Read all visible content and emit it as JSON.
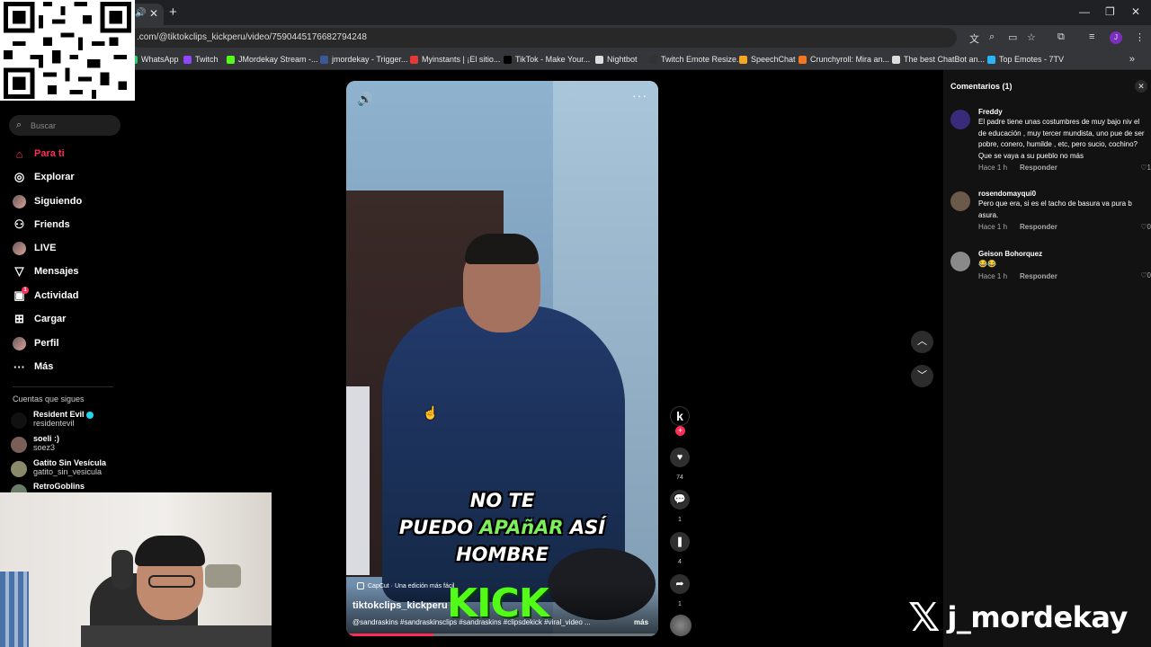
{
  "browser": {
    "url": ".com/@tiktokclips_kickperu/video/7590445176682794248",
    "bookmarks": [
      {
        "label": "WhatsApp",
        "color": "#25d366"
      },
      {
        "label": "Twitch",
        "color": "#9146ff"
      },
      {
        "label": "JMordekay Stream -...",
        "color": "#53fc18"
      },
      {
        "label": "jmordekay - Trigger...",
        "color": "#3b5998"
      },
      {
        "label": "Myinstants | ¡El sitio...",
        "color": "#e53935"
      },
      {
        "label": "TikTok - Make Your...",
        "color": "#000000"
      },
      {
        "label": "Nightbot",
        "color": "#dddddd"
      },
      {
        "label": "Twitch Emote Resize...",
        "color": "#333333"
      },
      {
        "label": "SpeechChat",
        "color": "#f5a623"
      },
      {
        "label": "Crunchyroll: Mira an...",
        "color": "#f47521"
      },
      {
        "label": "The best ChatBot an...",
        "color": "#dddddd"
      },
      {
        "label": "Top Emotes - 7TV",
        "color": "#29b6f6"
      }
    ]
  },
  "sidebar": {
    "search_placeholder": "Buscar",
    "nav": [
      {
        "label": "Para ti",
        "icon": "home-icon",
        "active": true
      },
      {
        "label": "Explorar",
        "icon": "compass-icon"
      },
      {
        "label": "Siguiendo",
        "icon": "following-avatar-icon"
      },
      {
        "label": "Friends",
        "icon": "friends-icon"
      },
      {
        "label": "LIVE",
        "icon": "live-icon"
      },
      {
        "label": "Mensajes",
        "icon": "messages-icon"
      },
      {
        "label": "Actividad",
        "icon": "activity-icon",
        "badge": "1"
      },
      {
        "label": "Cargar",
        "icon": "upload-icon"
      },
      {
        "label": "Perfil",
        "icon": "profile-avatar-icon"
      },
      {
        "label": "Más",
        "icon": "more-icon"
      }
    ],
    "following_title": "Cuentas que sigues",
    "accounts": [
      {
        "name": "Resident Evil",
        "handle": "residentevil",
        "verified": true
      },
      {
        "name": "soeli :)",
        "handle": "soez3"
      },
      {
        "name": "Gatito Sin Vesícula",
        "handle": "gatito_sin_vesicula"
      },
      {
        "name": "RetroGoblins",
        "handle": ""
      }
    ]
  },
  "video": {
    "caption_line1": "NO TE",
    "caption_line2a": "PUEDO ",
    "caption_line2b": "APAñAR",
    "caption_line2c": " ASÍ",
    "caption_line3": "HOMBRE",
    "capcut": "CapCut · Una edición más fácil",
    "watermark": "KICK",
    "author": "tiktokclips_kickperu",
    "description": "@sandraskins #sandraskinsclips #sandraskins #clipsdekick #viral_video ...",
    "more": "más",
    "progress": 0.28
  },
  "actions": {
    "avatar_letter": "k",
    "likes": "74",
    "comments": "1",
    "saves": "4",
    "shares": "1"
  },
  "comments_panel": {
    "title": "Comentarios (1)",
    "items": [
      {
        "name": "Freddy",
        "text": "El padre tiene unas costumbres de muy bajo niv el de educación , muy tercer mundista, uno pue de ser pobre, conero, humilde , etc, pero sucio, cochino? Que se vaya a su pueblo no más",
        "time": "Hace 1 h",
        "reply": "Responder",
        "likes": "1"
      },
      {
        "name": "rosendomayqui0",
        "text": "Pero que era, si es el tacho de basura va pura b asura.",
        "time": "Hace 1 h",
        "reply": "Responder",
        "likes": "0"
      },
      {
        "name": "Geison Bohorquez",
        "text": "😂😂",
        "time": "Hace 1 h",
        "reply": "Responder",
        "likes": "0"
      }
    ]
  },
  "overlay": {
    "x_logo": "𝕏",
    "handle": "j_mordekay"
  }
}
